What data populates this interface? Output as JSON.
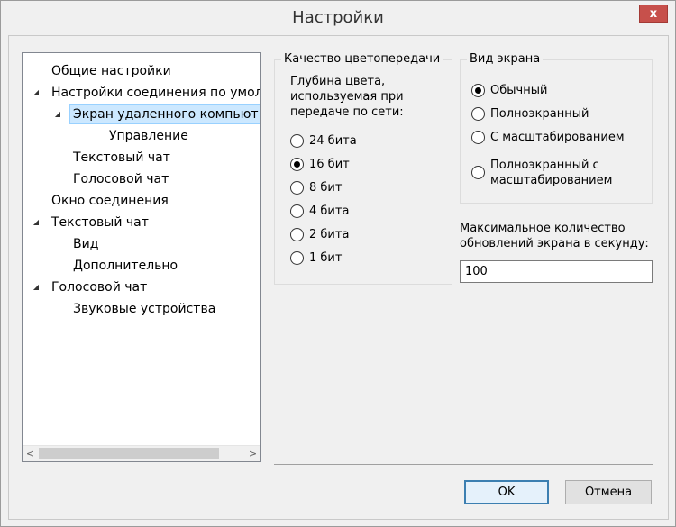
{
  "window": {
    "title": "Настройки",
    "close_label": "x"
  },
  "tree": {
    "items": [
      {
        "label": "Общие настройки",
        "level": 0,
        "expandable": false,
        "expanded": false,
        "selected": false
      },
      {
        "label": "Настройки соединения по умол.",
        "level": 0,
        "expandable": true,
        "expanded": true,
        "selected": false
      },
      {
        "label": "Экран удаленного компьют",
        "level": 1,
        "expandable": true,
        "expanded": true,
        "selected": true
      },
      {
        "label": "Управление",
        "level": 2,
        "expandable": false,
        "expanded": false,
        "selected": false
      },
      {
        "label": "Текстовый чат",
        "level": 1,
        "expandable": false,
        "expanded": false,
        "selected": false
      },
      {
        "label": "Голосовой чат",
        "level": 1,
        "expandable": false,
        "expanded": false,
        "selected": false
      },
      {
        "label": "Окно соединения",
        "level": 0,
        "expandable": false,
        "expanded": false,
        "selected": false
      },
      {
        "label": "Текстовый чат",
        "level": 0,
        "expandable": true,
        "expanded": true,
        "selected": false
      },
      {
        "label": "Вид",
        "level": 1,
        "expandable": false,
        "expanded": false,
        "selected": false
      },
      {
        "label": "Дополнительно",
        "level": 1,
        "expandable": false,
        "expanded": false,
        "selected": false
      },
      {
        "label": "Голосовой чат",
        "level": 0,
        "expandable": true,
        "expanded": true,
        "selected": false
      },
      {
        "label": "Звуковые устройства",
        "level": 1,
        "expandable": false,
        "expanded": false,
        "selected": false
      }
    ],
    "scroll_left": "<",
    "scroll_right": ">"
  },
  "color_quality": {
    "title": "Качество цветопередачи",
    "description": [
      "Глубина цвета,",
      "используемая при",
      "передаче по сети:"
    ],
    "options": [
      {
        "label": "24 бита",
        "checked": false
      },
      {
        "label": "16 бит",
        "checked": true
      },
      {
        "label": "8 бит",
        "checked": false
      },
      {
        "label": "4 бита",
        "checked": false
      },
      {
        "label": "2 бита",
        "checked": false
      },
      {
        "label": "1 бит",
        "checked": false
      }
    ]
  },
  "screen_view": {
    "title": "Вид экрана",
    "options": [
      {
        "label": "Обычный",
        "checked": true
      },
      {
        "label": "Полноэкранный",
        "checked": false
      },
      {
        "label": "С масштабированием",
        "checked": false
      },
      {
        "label": "Полноэкранный с масштабированием",
        "line1": "Полноэкранный с",
        "line2": "масштабированием",
        "checked": false
      }
    ]
  },
  "max_updates": {
    "label_line1": "Максимальное количество",
    "label_line2": "обновлений экрана в секунду:",
    "value": "100"
  },
  "buttons": {
    "ok": "OK",
    "cancel": "Отмена"
  }
}
